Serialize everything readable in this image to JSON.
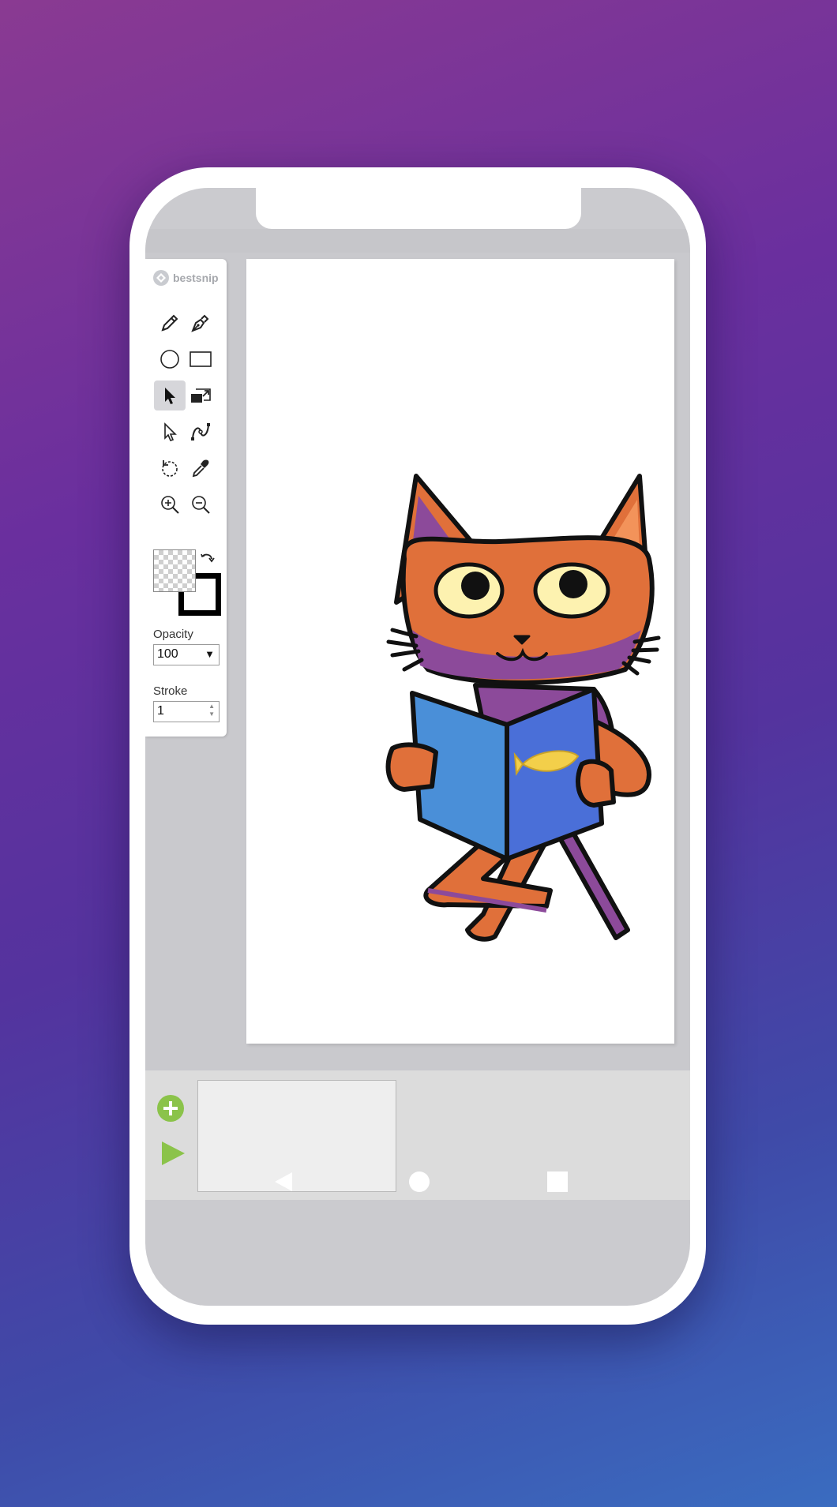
{
  "app": {
    "logo_text": "bestsnip"
  },
  "toolbar": {
    "tools": [
      {
        "name": "pencil-icon",
        "active": false
      },
      {
        "name": "pen-icon",
        "active": false
      },
      {
        "name": "ellipse-icon",
        "active": false
      },
      {
        "name": "rectangle-icon",
        "active": false
      },
      {
        "name": "select-arrow-icon",
        "active": true
      },
      {
        "name": "transform-icon",
        "active": false
      },
      {
        "name": "direct-select-icon",
        "active": false
      },
      {
        "name": "bezier-node-icon",
        "active": false
      },
      {
        "name": "lasso-rotate-icon",
        "active": false
      },
      {
        "name": "eyedropper-icon",
        "active": false
      },
      {
        "name": "zoom-in-icon",
        "active": false
      },
      {
        "name": "zoom-out-icon",
        "active": false
      }
    ],
    "fill_color": "transparent",
    "stroke_color": "#000000",
    "opacity_label": "Opacity",
    "opacity_value": "100",
    "stroke_label": "Stroke",
    "stroke_value": "1"
  },
  "colors": {
    "accent_green": "#8bc34a",
    "cat_orange": "#e0703a",
    "cat_purple": "#8c4a9a",
    "book_blue": "#4a8fd8",
    "fish_yellow": "#f3cf4a"
  },
  "timeline": {
    "add_frame_icon": "plus-circle-icon",
    "play_icon": "play-icon"
  },
  "navigation": {
    "back_icon": "back-triangle-icon",
    "home_icon": "home-circle-icon",
    "recents_icon": "recents-square-icon"
  }
}
